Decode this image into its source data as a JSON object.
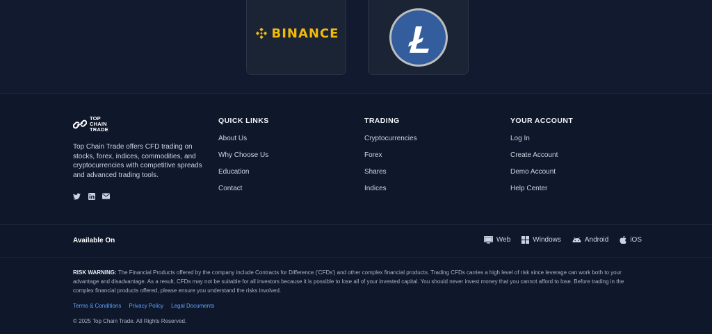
{
  "partners": {
    "binance": {
      "text": "BINANCE",
      "color": "#f0b90b"
    },
    "litecoin": {
      "icon": "litecoin-icon",
      "color": "#345d9d"
    }
  },
  "brand": {
    "line1": "TOP",
    "line2": "CHAIN",
    "line3": "TRADE",
    "description": "Top Chain Trade offers CFD trading on stocks, forex, indices, commodities, and cryptocurrencies with competitive spreads and advanced trading tools."
  },
  "social": [
    "twitter-icon",
    "linkedin-icon",
    "mail-icon"
  ],
  "quick_links": {
    "heading": "QUICK LINKS",
    "items": [
      "About Us",
      "Why Choose Us",
      "Education",
      "Contact"
    ]
  },
  "trading": {
    "heading": "TRADING",
    "items": [
      "Cryptocurrencies",
      "Forex",
      "Shares",
      "Indices"
    ]
  },
  "account": {
    "heading": "YOUR ACCOUNT",
    "items": [
      "Log In",
      "Create Account",
      "Demo Account",
      "Help Center"
    ]
  },
  "available": {
    "label": "Available On",
    "platforms": [
      {
        "label": "Web",
        "icon": "monitor-icon"
      },
      {
        "label": "Windows",
        "icon": "windows-icon"
      },
      {
        "label": "Android",
        "icon": "android-icon"
      },
      {
        "label": "iOS",
        "icon": "apple-icon"
      }
    ]
  },
  "risk": {
    "label": "RISK WARNING:",
    "text": "The Financial Products offered by the company include Contracts for Difference ('CFDs') and other complex financial products. Trading CFDs carries a high level of risk since leverage can work both to your advantage and disadvantage. As a result, CFDs may not be suitable for all investors because it is possible to lose all of your invested capital. You should never invest money that you cannot afford to lose. Before trading in the complex financial products offered, please ensure you understand the risks involved."
  },
  "legal": [
    "Terms & Conditions",
    "Privacy Policy",
    "Legal Documents"
  ],
  "copyright": "© 2025 Top Chain Trade. All Rights Reserved.",
  "colors": {
    "background": "#0f172a",
    "accent_link": "#60a5fa",
    "binance_yellow": "#f0b90b"
  }
}
